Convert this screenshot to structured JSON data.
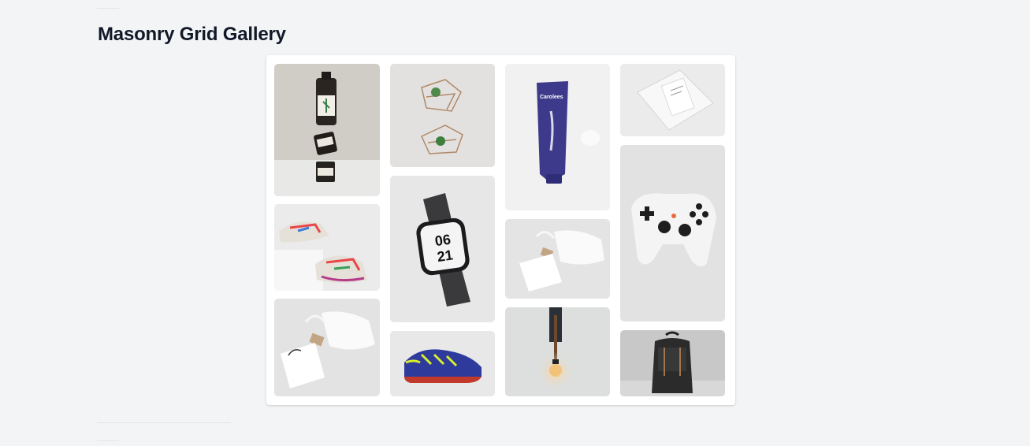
{
  "page": {
    "title": "Masonry Grid Gallery"
  },
  "gallery": {
    "items": [
      {
        "name": "bottle-stack-photo",
        "bg": "#ceccc4"
      },
      {
        "name": "air-plant-shelves-photo",
        "bg": "#e3e1df"
      },
      {
        "name": "cream-tube-photo",
        "bg": "#f0f0f0"
      },
      {
        "name": "ziplock-bag-photo",
        "bg": "#e9e9e9"
      },
      {
        "name": "sneakers-photo",
        "bg": "#ececec"
      },
      {
        "name": "smartwatch-photo",
        "bg": "#e7e7e7"
      },
      {
        "name": "tote-pouch-photo",
        "bg": "#e4e4e4"
      },
      {
        "name": "game-controller-photo",
        "bg": "#e2e2e2"
      },
      {
        "name": "drawstring-pouch-photo",
        "bg": "#e4e4e4"
      },
      {
        "name": "soccer-shoe-photo",
        "bg": "#e8e8e8"
      },
      {
        "name": "pendant-lamp-photo",
        "bg": "#dcdfde"
      },
      {
        "name": "leather-backpack-photo",
        "bg": "#c9c9c9"
      }
    ]
  }
}
